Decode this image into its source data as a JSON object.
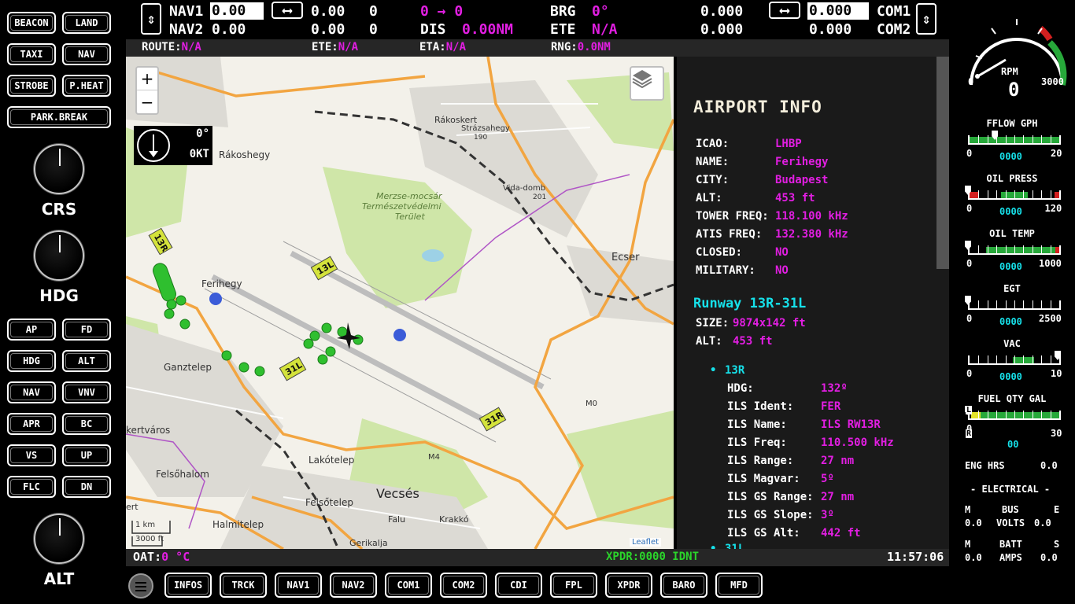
{
  "left_panel": {
    "buttons": [
      "BEACON",
      "LAND",
      "TAXI",
      "NAV",
      "STROBE",
      "P.HEAT",
      "PARK.BREAK"
    ],
    "knobs": [
      "CRS",
      "HDG",
      "ALT"
    ],
    "ap_buttons": [
      "AP",
      "FD",
      "HDG",
      "ALT",
      "NAV",
      "VNV",
      "APR",
      "BC",
      "VS",
      "UP",
      "FLC",
      "DN"
    ]
  },
  "top_bar": {
    "nav1_label": "NAV1",
    "nav1_active": "0.00",
    "nav1_swap": "⟷",
    "nav1_standby": "0.00",
    "nav1_radial": "0",
    "nav2_label": "NAV2",
    "nav2_active": "0.00",
    "nav2_standby": "0.00",
    "nav2_radial": "0",
    "leg": "0 → 0",
    "dis_label": "DIS",
    "dis_value": "0.00NM",
    "brg_label": "BRG",
    "brg_value": "0°",
    "ete_label": "ETE",
    "ete_value": "N/A",
    "com1_active_left": "0.000",
    "com2_active_left": "0.000",
    "com1_standby": "0.000",
    "com2_standby": "0.000",
    "com1_label": "COM1",
    "com2_label": "COM2",
    "vswap": "⇕"
  },
  "route_bar": {
    "route_label": "ROUTE:",
    "route_value": "N/A",
    "ete_label": "ETE:",
    "ete_value": "N/A",
    "eta_label": "ETA:",
    "eta_value": "N/A",
    "rng_label": "RNG:",
    "rng_value": "0.0NM"
  },
  "map": {
    "zoom_in": "+",
    "zoom_out": "−",
    "wind_dir": "0°",
    "wind_speed": "0KT",
    "labels": {
      "rakoskert": "Rákoskert",
      "strazsahegy": "Strázsahegy",
      "strazsahegy_alt": "190",
      "rakoshegy": "Rákoshegy",
      "merzse1": "Merzse-mocsár",
      "merzse2": "Természetvédelmi",
      "merzse3": "Terület",
      "vidadomb": "Vida-domb",
      "vidadomb_alt": "201",
      "ecser": "Ecser",
      "ferihegy": "Ferihegy",
      "ganztelep": "Ganztelep",
      "kertvaros": "kertváros",
      "lakotelep": "Lakótelep",
      "felsohalom": "Felsőhalom",
      "felsotelep": "Felsőtelep",
      "vecses": "Vecsés",
      "halmitelep": "Halmitelep",
      "falu": "Falu",
      "krakko": "Krakkó",
      "gerikalja": "Gerikalja",
      "m4": "M4",
      "m0": "M0",
      "ert": "ert"
    },
    "runway_signs": [
      "13R",
      "13L",
      "31L",
      "31R"
    ],
    "scale_km": "1 km",
    "scale_ft": "3000 ft",
    "attribution": "Leaflet"
  },
  "airport_info": {
    "title": "AIRPORT INFO",
    "rows": [
      {
        "label": "ICAO:",
        "value": "LHBP"
      },
      {
        "label": "NAME:",
        "value": "Ferihegy"
      },
      {
        "label": "CITY:",
        "value": "Budapest"
      },
      {
        "label": "ALT:",
        "value": "453 ft"
      },
      {
        "label": "TOWER FREQ:",
        "value": "118.100 kHz"
      },
      {
        "label": "ATIS FREQ:",
        "value": "132.380 kHz"
      },
      {
        "label": "CLOSED:",
        "value": "NO"
      },
      {
        "label": "MILITARY:",
        "value": "NO"
      }
    ],
    "runway_title": "Runway 13R-31L",
    "runway_size_label": "SIZE:",
    "runway_size": "9874x142 ft",
    "runway_alt_label": "ALT:",
    "runway_alt": "453 ft",
    "end_ident": "13R",
    "end_rows": [
      {
        "label": "HDG:",
        "value": "132º"
      },
      {
        "label": "ILS Ident:",
        "value": "FER"
      },
      {
        "label": "ILS Name:",
        "value": "ILS RW13R"
      },
      {
        "label": "ILS Freq:",
        "value": "110.500 kHz"
      },
      {
        "label": "ILS Range:",
        "value": "27 nm"
      },
      {
        "label": "ILS Magvar:",
        "value": "5º"
      },
      {
        "label": "ILS GS Range:",
        "value": "27 nm"
      },
      {
        "label": "ILS GS Slope:",
        "value": "3º"
      },
      {
        "label": "ILS GS Alt:",
        "value": "442 ft"
      }
    ],
    "next_end_partial": "31L"
  },
  "status_bar": {
    "oat_label": "OAT:",
    "oat_value": "0 °C",
    "xpdr_label": "XPDR:",
    "xpdr_value": "0000 IDNT",
    "clock": "11:57:06"
  },
  "bottom_tabs": [
    "INFOS",
    "TRCK",
    "NAV1",
    "NAV2",
    "COM1",
    "COM2",
    "CDI",
    "FPL",
    "XPDR",
    "BARO",
    "MFD"
  ],
  "engine": {
    "rpm_label": "RPM",
    "rpm_value": "0",
    "rpm_min": "0",
    "rpm_max": "3000",
    "gauges": [
      {
        "label": "FFLOW GPH",
        "min": "0",
        "max": "20",
        "value": "0000",
        "level": 0.3
      },
      {
        "label": "OIL PRESS",
        "min": "0",
        "max": "120",
        "value": "0000",
        "level": 0.0
      },
      {
        "label": "OIL TEMP",
        "min": "0",
        "max": "1000",
        "value": "0000",
        "level": 0.0
      },
      {
        "label": "EGT",
        "min": "0",
        "max": "2500",
        "value": "0000",
        "level": 0.0
      },
      {
        "label": "VAC",
        "min": "0",
        "max": "10",
        "value": "0000",
        "level": 1.0
      },
      {
        "label": "FUEL QTY GAL",
        "min": "0",
        "max": "30",
        "value": "00",
        "level": 0.0
      }
    ],
    "fuel_left": "L",
    "fuel_right": "R",
    "eng_hrs_label": "ENG HRS",
    "eng_hrs_value": "0.0",
    "electrical_title": "- ELECTRICAL -",
    "elec_m1": "M",
    "elec_bus": "BUS",
    "elec_e": "E",
    "elec_m1_val": "0.0",
    "elec_volts": "VOLTS",
    "elec_e_val": "0.0",
    "elec_m2": "M",
    "elec_batt": "BATT",
    "elec_s": "S",
    "elec_m2_val": "0.0",
    "elec_amps": "AMPS",
    "elec_s_val": "0.0"
  },
  "colors": {
    "magenta": "#e21ee2",
    "cyan": "#16e0e9",
    "green": "#2bd42b",
    "panel": "#1a1a1a"
  }
}
